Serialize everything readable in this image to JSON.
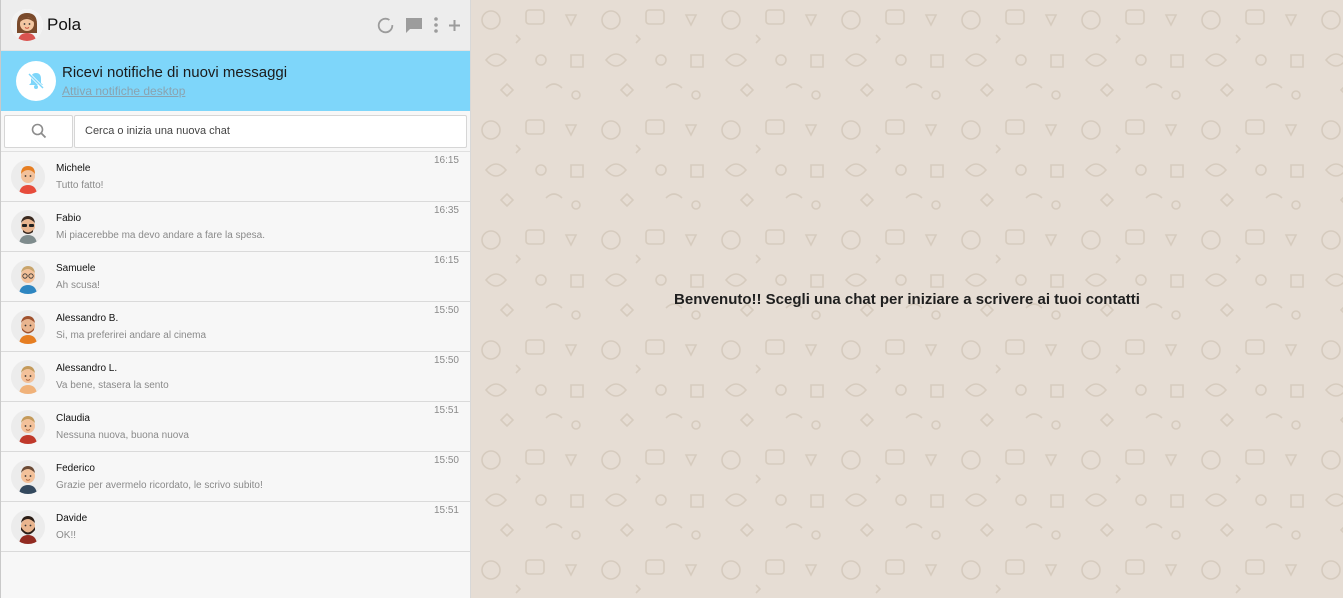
{
  "user": {
    "name": "Pola",
    "avatar": "woman-avatar"
  },
  "header_icons": [
    "status-icon",
    "chat-icon",
    "menu-icon",
    "add-icon"
  ],
  "notification": {
    "title": "Ricevi notifiche di nuovi messaggi",
    "link": "Attiva notifiche desktop",
    "icon": "bell-off-icon"
  },
  "search": {
    "placeholder": "Cerca o inizia una nuova chat",
    "icon": "search-icon"
  },
  "chats": [
    {
      "name": "Michele",
      "last_message": "Tutto fatto!",
      "time": "16:15"
    },
    {
      "name": "Fabio",
      "last_message": "Mi piacerebbe ma devo andare a fare la spesa.",
      "time": "16:35"
    },
    {
      "name": "Samuele",
      "last_message": "Ah scusa!",
      "time": "16:15"
    },
    {
      "name": "Alessandro B.",
      "last_message": "Si, ma preferirei andare al cinema",
      "time": "15:50"
    },
    {
      "name": "Alessandro L.",
      "last_message": "Va bene, stasera la sento",
      "time": "15:50"
    },
    {
      "name": "Claudia",
      "last_message": "Nessuna nuova, buona nuova",
      "time": "15:51"
    },
    {
      "name": "Federico",
      "last_message": "Grazie per avermelo ricordato, le scrivo subito!",
      "time": "15:50"
    },
    {
      "name": "Davide",
      "last_message": "OK!!",
      "time": "15:51"
    }
  ],
  "main": {
    "welcome": "Benvenuto!! Scegli una chat per iniziare a scrivere ai tuoi contatti"
  },
  "colors": {
    "notification_bg": "#7ed6fa",
    "chat_bg": "#e6ddd4",
    "topbar_bg": "#ededed"
  }
}
